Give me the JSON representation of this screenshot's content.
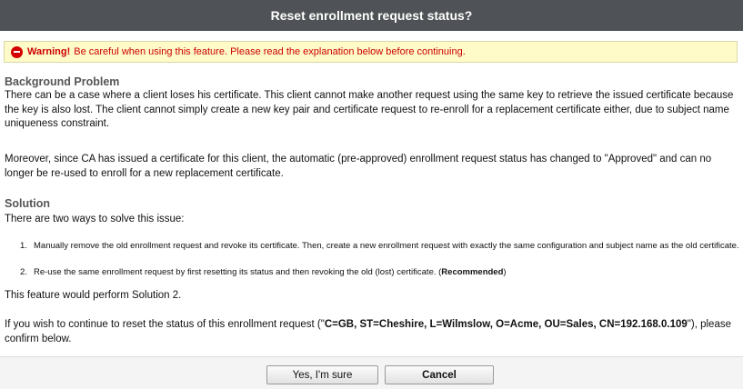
{
  "dialog": {
    "title": "Reset enrollment request status?"
  },
  "warning": {
    "icon": "no-entry-icon",
    "label": "Warning!",
    "message": "Be careful when using this feature. Please read the explanation below before continuing."
  },
  "background": {
    "heading": "Background Problem",
    "paragraph1": "There can be a case where a client loses his certificate. This client cannot make another request using the same key to retrieve the issued certificate because the key is also lost. The client cannot simply create a new key pair and certificate request to re-enroll for a replacement certificate either, due to subject name uniqueness constraint.",
    "paragraph2": "Moreover, since CA has issued a certificate for this client, the automatic (pre-approved) enrollment request status has changed to \"Approved\" and can no longer be re-used to enroll for a new replacement certificate."
  },
  "solution": {
    "heading": "Solution",
    "intro": "There are two ways to solve this issue:",
    "items": [
      {
        "num": "1.",
        "text": "Manually remove the old enrollment request and revoke its certificate. Then, create a new enrollment request with exactly the same configuration and subject name as the old certificate."
      },
      {
        "num": "2.",
        "text": "Re-use the same enrollment request by first resetting its status and then revoking the old (lost) certificate. (",
        "strong": "Recommended",
        "suffix": ")"
      }
    ],
    "summary": "This feature would perform Solution 2."
  },
  "confirm": {
    "prefix": "If you wish to continue to reset the status of this enrollment request (\"",
    "subject": "C=GB, ST=Cheshire, L=Wilmslow, O=Acme, OU=Sales, CN=192.168.0.109",
    "suffix": "\"), please confirm below."
  },
  "buttons": {
    "yes": "Yes, I'm sure",
    "cancel": "Cancel"
  }
}
